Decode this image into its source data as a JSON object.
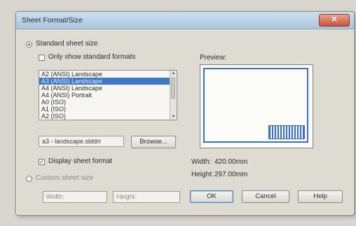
{
  "dialog": {
    "title": "Sheet Format/Size",
    "close_label": "✕"
  },
  "standard": {
    "radio_label": "Standard sheet size",
    "only_standard_label": "Only show standard formats",
    "items": [
      "A2 (ANSI) Landscape",
      "A3 (ANSI) Landscape",
      "A4 (ANSI) Landscape",
      "A4 (ANSI) Portrait",
      "A0 (ISO)",
      "A1 (ISO)",
      "A2 (ISO)"
    ],
    "selected_index": 1,
    "file_value": "a3 - landscape.slddrt",
    "browse_label": "Browse...",
    "display_format_label": "Display sheet format"
  },
  "custom": {
    "radio_label": "Custom sheet size",
    "width_placeholder": "Width:",
    "height_placeholder": "Height:"
  },
  "preview": {
    "label": "Preview:",
    "width_label": "Width:",
    "width_value": "420.00mm",
    "height_label": "Height:",
    "height_value": "297.00mm"
  },
  "buttons": {
    "ok": "OK",
    "cancel": "Cancel",
    "help": "Help"
  }
}
